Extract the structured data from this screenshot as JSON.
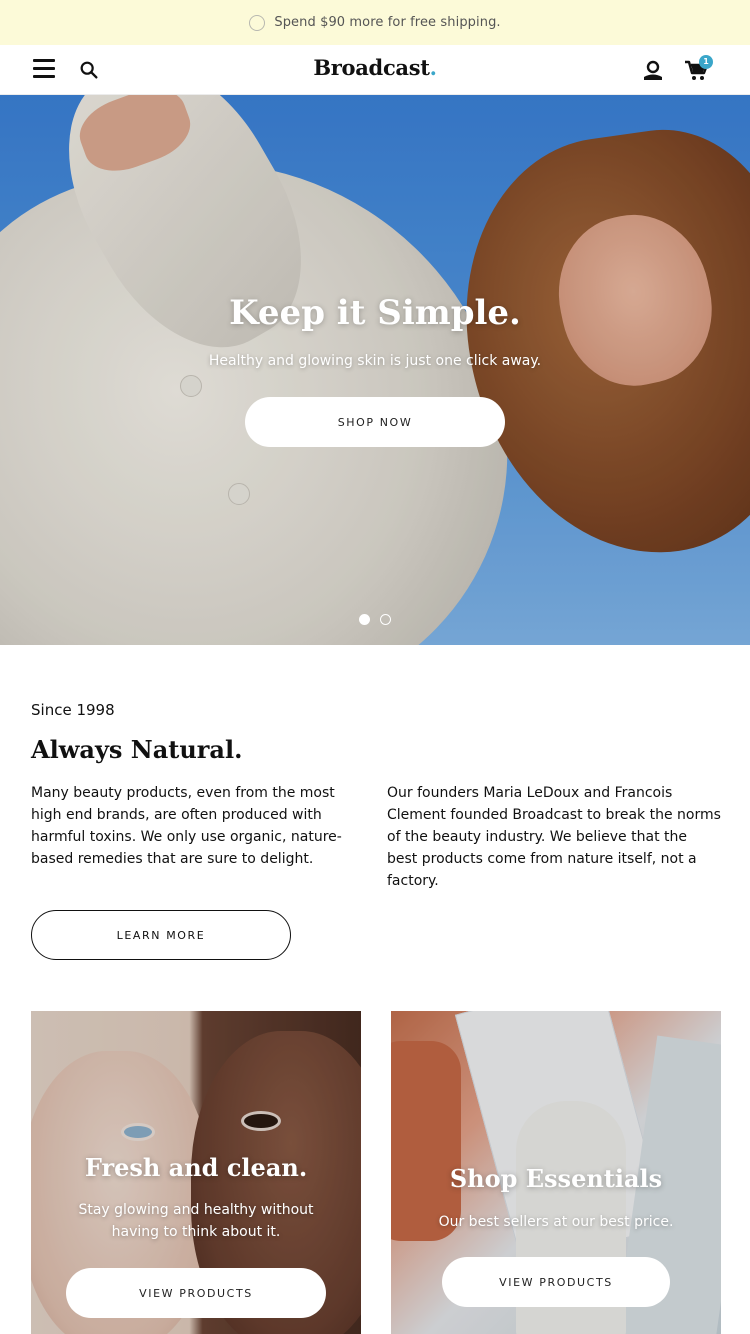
{
  "announcement": {
    "text": "Spend $90 more for free shipping."
  },
  "header": {
    "logo_text": "Broadcast",
    "logo_dot": ".",
    "cart_count": "1",
    "icons": [
      "menu-icon",
      "search-icon",
      "account-icon",
      "cart-icon"
    ],
    "accent_color": "#3aa6c9"
  },
  "hero": {
    "title": "Keep it Simple.",
    "subtitle": "Healthy and glowing skin is just one click away.",
    "button_label": "SHOP NOW",
    "slide_count": 2,
    "active_slide": 1
  },
  "about": {
    "eyebrow": "Since 1998",
    "title": "Always Natural.",
    "col_left": "Many beauty products, even from the most high end brands, are often produced with harmful toxins. We only use organic, nature-based remedies that are sure to delight.",
    "col_right": "Our founders Maria LeDoux and Francois Clement founded Broadcast to break the norms of the beauty industry. We believe that the best products come from nature itself, not a factory.",
    "button_label": "LEARN MORE"
  },
  "cards": [
    {
      "title": "Fresh and clean.",
      "subtitle": "Stay glowing and healthy without having to think about it.",
      "button_label": "VIEW PRODUCTS"
    },
    {
      "title": "Shop Essentials",
      "subtitle": "Our best sellers at our best price.",
      "button_label": "VIEW PRODUCTS"
    }
  ]
}
